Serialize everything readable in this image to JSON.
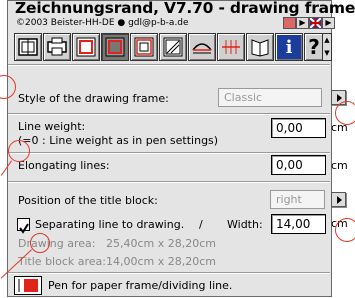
{
  "header": {
    "title": "Zeichnungsrand, V7.70 - drawing frame",
    "copyright": "©2003 Beister-HH-DE ● gdl@p-b-a.de"
  },
  "toolbar": {
    "icons": [
      "frame-icon",
      "printer-icon",
      "red-frame-icon",
      "frame-active-icon",
      "frame-double-icon",
      "hatch-frame-icon",
      "curve-icon",
      "grid-icon",
      "book-icon",
      "info-icon",
      "help-icon",
      "scroll-icon"
    ],
    "info_glyph": "i",
    "help_glyph": "?"
  },
  "style_row": {
    "label": "Style of the drawing frame:",
    "value": "Classic"
  },
  "line_weight": {
    "label": "Line weight:",
    "hint": "(=0 : Line weight as in pen settings)",
    "value": "0,00",
    "unit": "cm"
  },
  "elongating": {
    "label": "Elongating lines:",
    "value": "0,00",
    "unit": "cm"
  },
  "title_block": {
    "label": "Position of the title block:",
    "value": "right"
  },
  "separating": {
    "label": "Separating line to drawing.",
    "slash": "/",
    "width_label": "Width:",
    "value": "14,00",
    "unit": "cm",
    "checked": true
  },
  "areas": {
    "drawing_label": "Drawing area:",
    "drawing_value": "25,40cm x 28,20cm",
    "title_label": "Title block area:",
    "title_value": "14,00cm x 28,20cm"
  },
  "pen": {
    "label": "Pen for paper frame/dividing line.",
    "color": "#e0241b"
  },
  "colors": {
    "accent": "#e2382a",
    "panel": "#e4e4e4"
  }
}
